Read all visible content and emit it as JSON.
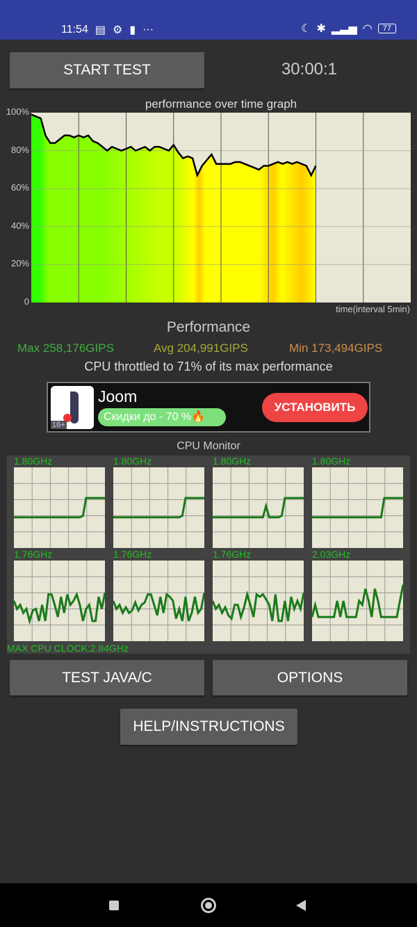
{
  "status_bar": {
    "time": "11:54",
    "battery": "77",
    "icons": [
      "calendar-icon",
      "gear-icon",
      "keyhole-icon",
      "more-icon",
      "moon-icon",
      "bluetooth-icon",
      "signal-icon",
      "wifi-icon",
      "battery-icon"
    ]
  },
  "toolbar": {
    "start_label": "START TEST",
    "timer": "30:00:1"
  },
  "graph": {
    "title": "performance over time graph",
    "y_ticks": [
      "100%",
      "80%",
      "60%",
      "40%",
      "20%",
      "0"
    ],
    "x_label": "time(interval 5min)"
  },
  "chart_data": {
    "type": "area",
    "title": "performance over time graph",
    "xlabel": "time(interval 5min)",
    "ylabel": "",
    "xlim": [
      0,
      40
    ],
    "ylim": [
      0,
      100
    ],
    "grid": true,
    "x_unit": "min",
    "x": [
      0,
      0.5,
      1,
      1.5,
      2,
      2.5,
      3,
      3.5,
      4,
      4.5,
      5,
      5.5,
      6,
      6.5,
      7,
      7.5,
      8,
      8.5,
      9,
      9.5,
      10,
      10.5,
      11,
      11.5,
      12,
      12.5,
      13,
      13.5,
      14,
      14.5,
      15,
      15.5,
      16,
      16.5,
      17,
      17.5,
      18,
      18.5,
      19,
      19.5,
      20,
      20.5,
      21,
      21.5,
      22,
      22.5,
      23,
      23.5,
      24,
      24.5,
      25,
      25.5,
      26,
      26.5,
      27,
      27.5,
      28,
      28.5,
      29,
      29.5,
      30
    ],
    "values": [
      99,
      98,
      97,
      88,
      84,
      84,
      86,
      88,
      88,
      87,
      88,
      87,
      88,
      85,
      84,
      82,
      80,
      82,
      81,
      80,
      81,
      82,
      80,
      81,
      82,
      80,
      82,
      82,
      81,
      80,
      83,
      79,
      76,
      77,
      76,
      67,
      72,
      75,
      78,
      73,
      73,
      73,
      73,
      74,
      74,
      73,
      72,
      71,
      70,
      72,
      72,
      73,
      74,
      73,
      74,
      73,
      74,
      73,
      72,
      67,
      72
    ],
    "fill_colors": [
      "#33ff00",
      "#88ff00",
      "#c8ff00",
      "#ffff00",
      "#ffcc00"
    ]
  },
  "performance": {
    "title": "Performance",
    "max": "Max 258,176GIPS",
    "avg": "Avg 204,991GIPS",
    "min": "Min 173,494GIPS",
    "throttle": "CPU throttled to 71% of its max performance"
  },
  "ad": {
    "app": "Joom",
    "promo": "Скидки до - 70 %🔥",
    "install": "УСТАНОВИТЬ",
    "age": "16+"
  },
  "cpu_monitor": {
    "title": "CPU Monitor",
    "max_clock": "MAX CPU CLOCK:2.84GHz",
    "cores": [
      {
        "freq": "1.80GHz",
        "load": [
          0.38,
          0.38,
          0.38,
          0.38,
          0.38,
          0.38,
          0.38,
          0.38,
          0.38,
          0.38,
          0.38,
          0.38,
          0.38,
          0.38,
          0.38,
          0.38,
          0.38,
          0.38,
          0.38,
          0.38,
          0.38,
          0.38,
          0.4,
          0.62,
          0.62,
          0.62,
          0.62,
          0.62,
          0.62,
          0.62
        ]
      },
      {
        "freq": "1.80GHz",
        "load": [
          0.38,
          0.38,
          0.38,
          0.38,
          0.38,
          0.38,
          0.38,
          0.38,
          0.38,
          0.38,
          0.38,
          0.38,
          0.38,
          0.38,
          0.38,
          0.38,
          0.38,
          0.38,
          0.38,
          0.38,
          0.38,
          0.38,
          0.4,
          0.62,
          0.62,
          0.62,
          0.62,
          0.62,
          0.62,
          0.62
        ]
      },
      {
        "freq": "1.80GHz",
        "load": [
          0.38,
          0.38,
          0.38,
          0.38,
          0.38,
          0.38,
          0.38,
          0.38,
          0.38,
          0.38,
          0.38,
          0.38,
          0.38,
          0.38,
          0.38,
          0.38,
          0.38,
          0.52,
          0.38,
          0.38,
          0.38,
          0.38,
          0.4,
          0.62,
          0.62,
          0.62,
          0.62,
          0.62,
          0.62,
          0.62
        ]
      },
      {
        "freq": "1.80GHz",
        "load": [
          0.38,
          0.38,
          0.38,
          0.38,
          0.38,
          0.38,
          0.38,
          0.38,
          0.38,
          0.38,
          0.38,
          0.38,
          0.38,
          0.38,
          0.38,
          0.38,
          0.38,
          0.38,
          0.38,
          0.38,
          0.38,
          0.38,
          0.38,
          0.62,
          0.62,
          0.62,
          0.62,
          0.62,
          0.62,
          0.62
        ]
      },
      {
        "freq": "1.76GHz",
        "load": [
          0.5,
          0.4,
          0.45,
          0.35,
          0.4,
          0.25,
          0.38,
          0.4,
          0.25,
          0.45,
          0.25,
          0.58,
          0.58,
          0.45,
          0.3,
          0.55,
          0.35,
          0.58,
          0.45,
          0.5,
          0.58,
          0.45,
          0.25,
          0.4,
          0.45,
          0.25,
          0.25,
          0.55,
          0.4,
          0.6
        ]
      },
      {
        "freq": "1.76GHz",
        "load": [
          0.5,
          0.4,
          0.45,
          0.35,
          0.42,
          0.35,
          0.38,
          0.48,
          0.38,
          0.45,
          0.48,
          0.58,
          0.58,
          0.45,
          0.32,
          0.55,
          0.35,
          0.58,
          0.55,
          0.5,
          0.28,
          0.4,
          0.25,
          0.55,
          0.25,
          0.35,
          0.55,
          0.35,
          0.4,
          0.6
        ]
      },
      {
        "freq": "1.76GHz",
        "load": [
          0.5,
          0.4,
          0.45,
          0.35,
          0.42,
          0.32,
          0.28,
          0.45,
          0.45,
          0.3,
          0.42,
          0.58,
          0.45,
          0.3,
          0.58,
          0.55,
          0.58,
          0.52,
          0.45,
          0.25,
          0.58,
          0.25,
          0.25,
          0.5,
          0.25,
          0.55,
          0.4,
          0.5,
          0.4,
          0.6
        ]
      },
      {
        "freq": "2.03GHz",
        "load": [
          0.3,
          0.45,
          0.3,
          0.3,
          0.3,
          0.3,
          0.3,
          0.3,
          0.5,
          0.3,
          0.5,
          0.3,
          0.3,
          0.3,
          0.3,
          0.5,
          0.45,
          0.65,
          0.5,
          0.3,
          0.65,
          0.5,
          0.3,
          0.3,
          0.3,
          0.3,
          0.3,
          0.3,
          0.5,
          0.7
        ]
      }
    ]
  },
  "buttons": {
    "test": "TEST JAVA/C",
    "options": "OPTIONS",
    "help": "HELP/INSTRUCTIONS"
  },
  "nav": {
    "icons": [
      "recents-icon",
      "home-icon",
      "back-icon"
    ]
  }
}
